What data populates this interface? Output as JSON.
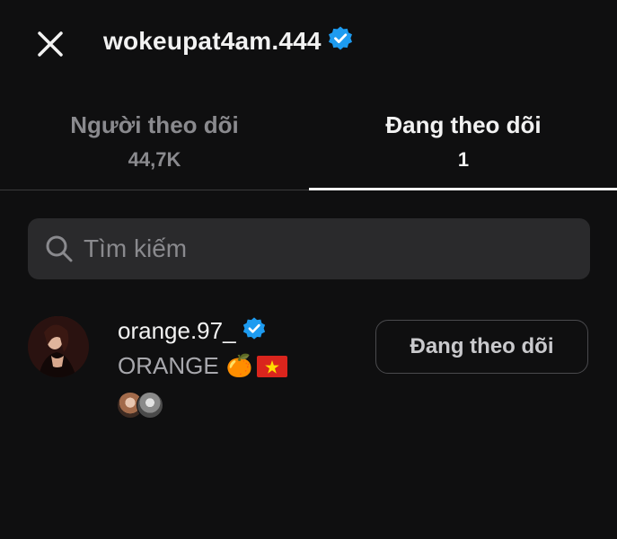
{
  "header": {
    "title": "wokeupat4am.444",
    "close_icon": "close-icon",
    "verified_icon": "verified-badge-icon",
    "verified_color": "#1d9bf0"
  },
  "tabs": [
    {
      "label": "Người theo dõi",
      "count": "44,7K",
      "active": false
    },
    {
      "label": "Đang theo dõi",
      "count": "1",
      "active": true
    }
  ],
  "search": {
    "placeholder": "Tìm kiếm",
    "value": "",
    "icon": "search-icon"
  },
  "following": [
    {
      "username": "orange.97_",
      "verified": true,
      "full_name": "ORANGE",
      "emoji": "🍊",
      "flag_icon": "vietnam-flag-icon",
      "button_label": "Đang theo dõi"
    }
  ],
  "colors": {
    "background": "#0f0f10",
    "search_bg": "#2a2a2c",
    "muted_text": "#8a8a8e",
    "primary_text": "#f2f2f2"
  }
}
